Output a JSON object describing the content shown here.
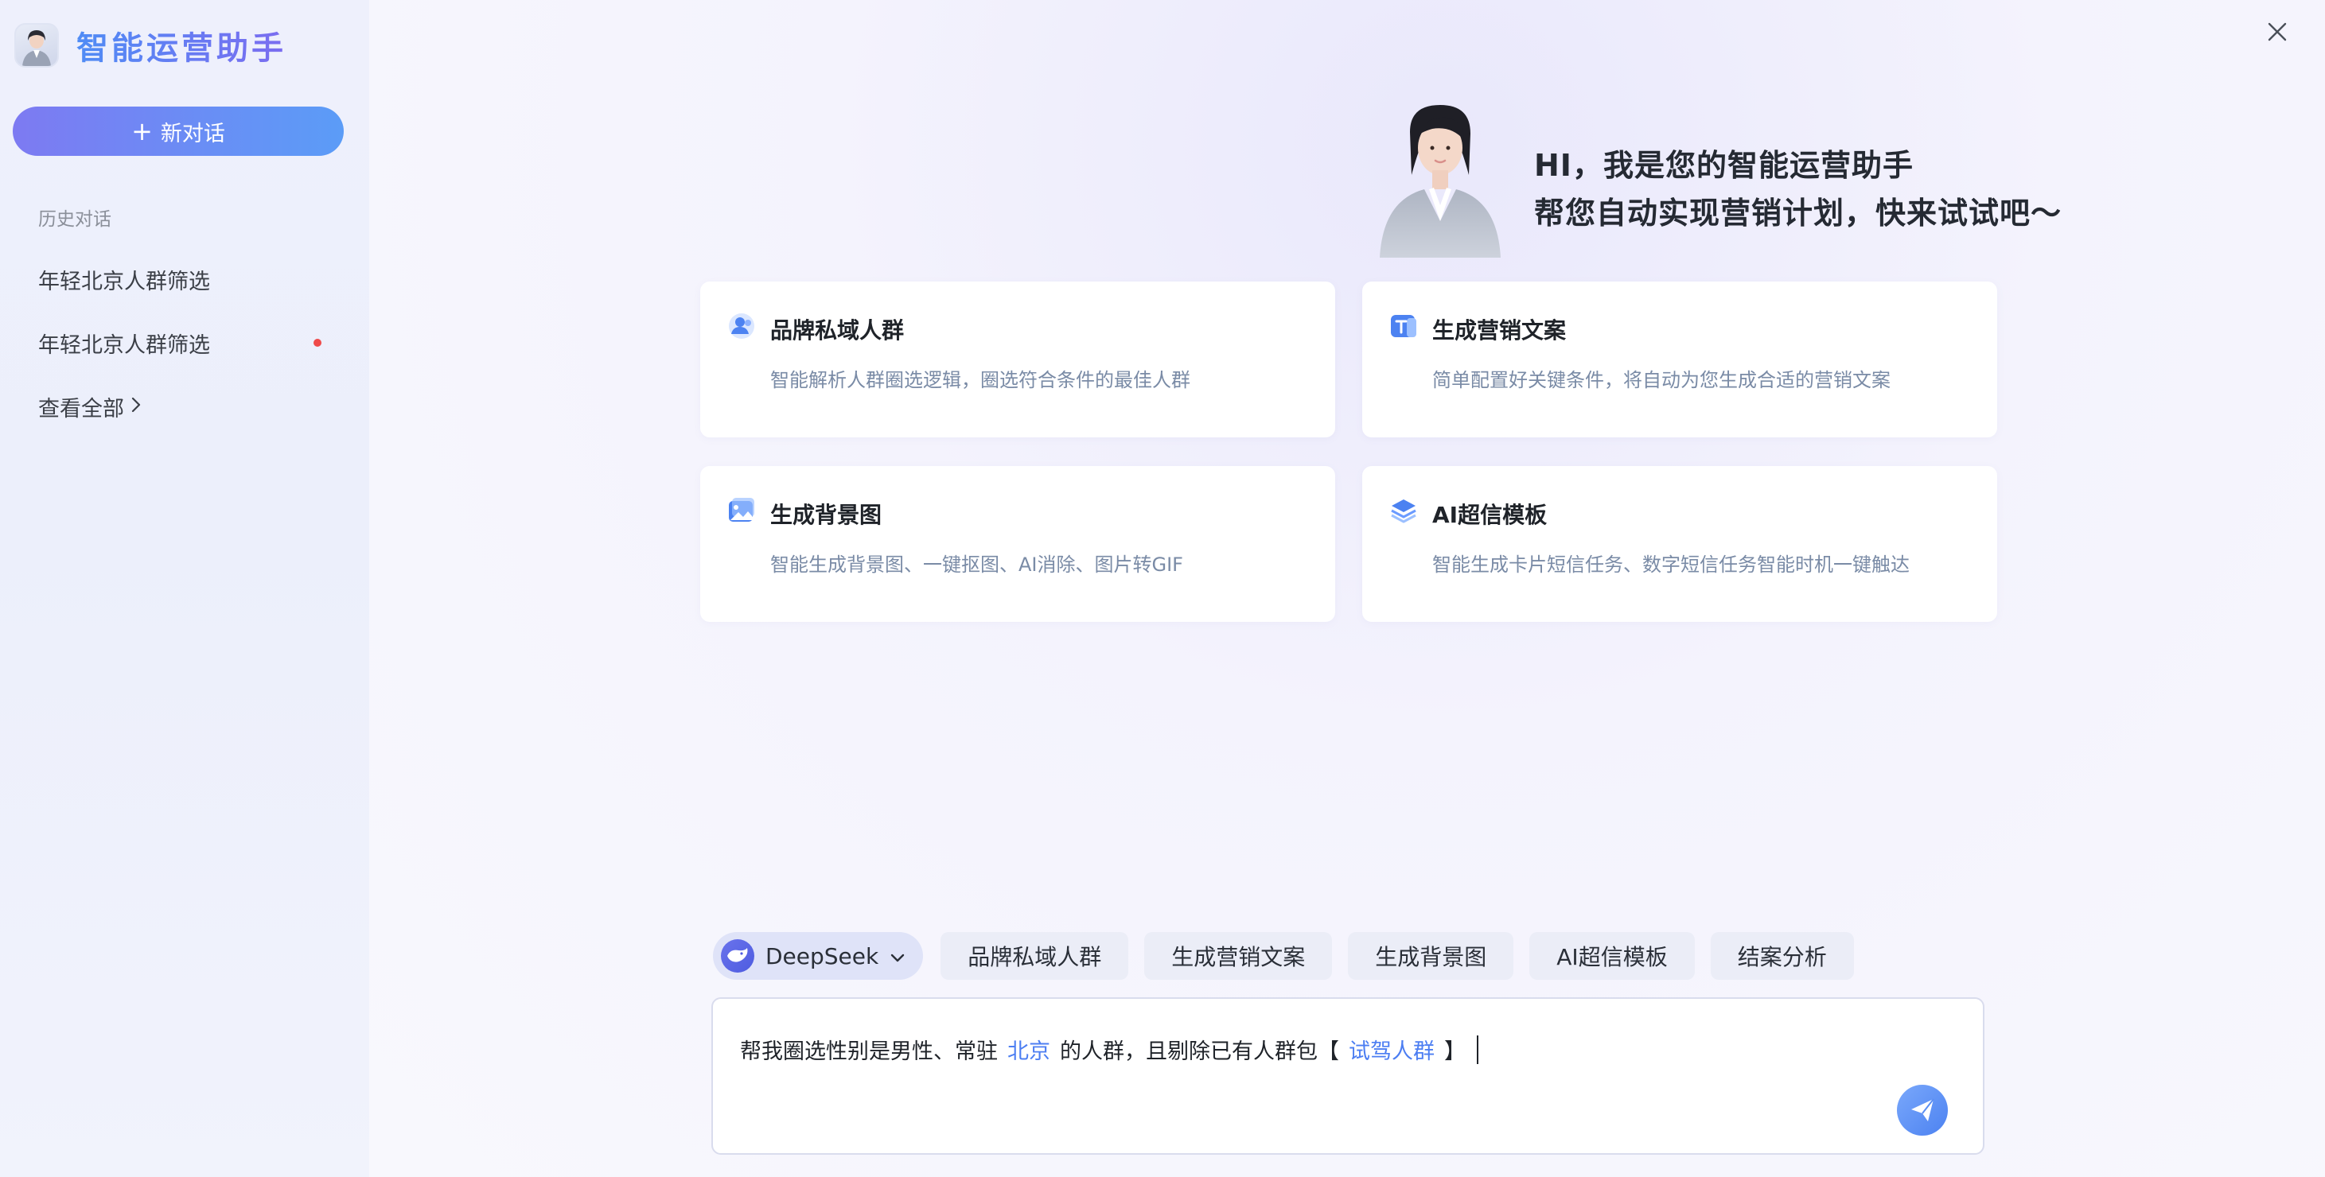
{
  "app": {
    "title": "智能运营助手"
  },
  "sidebar": {
    "new_chat_label": "新对话",
    "history_label": "历史对话",
    "history_items": [
      {
        "label": "年轻北京人群筛选",
        "unread": false
      },
      {
        "label": "年轻北京人群筛选",
        "unread": true
      }
    ],
    "see_all_label": "查看全部",
    "unread_dot_color": "#ef4a4a",
    "accent_gradient": [
      "#7d7af2",
      "#5b9cf7"
    ]
  },
  "hero": {
    "line1": "HI，我是您的智能运营助手",
    "line2": "帮您自动实现营销计划，快来试试吧～"
  },
  "cards": [
    {
      "icon": "people-icon",
      "title": "品牌私域人群",
      "desc": "智能解析人群圈选逻辑，圈选符合条件的最佳人群"
    },
    {
      "icon": "text-icon",
      "title": "生成营销文案",
      "desc": "简单配置好关键条件，将自动为您生成合适的营销文案"
    },
    {
      "icon": "image-icon",
      "title": "生成背景图",
      "desc": "智能生成背景图、一键抠图、AI消除、图片转GIF"
    },
    {
      "icon": "layers-icon",
      "title": "AI超信模板",
      "desc": "智能生成卡片短信任务、数字短信任务智能时机一键触达"
    }
  ],
  "composer": {
    "model_label": "DeepSeek",
    "quick_chips": [
      "品牌私域人群",
      "生成营销文案",
      "生成背景图",
      "AI超信模板",
      "结案分析"
    ],
    "input_parts": {
      "before": "帮我圈选性别是男性、常驻",
      "city": "北京",
      "middle": "的人群，且剔除已有人群包【",
      "tag": "试驾人群",
      "after": "】"
    },
    "highlight_color": "#4c7ef2"
  }
}
